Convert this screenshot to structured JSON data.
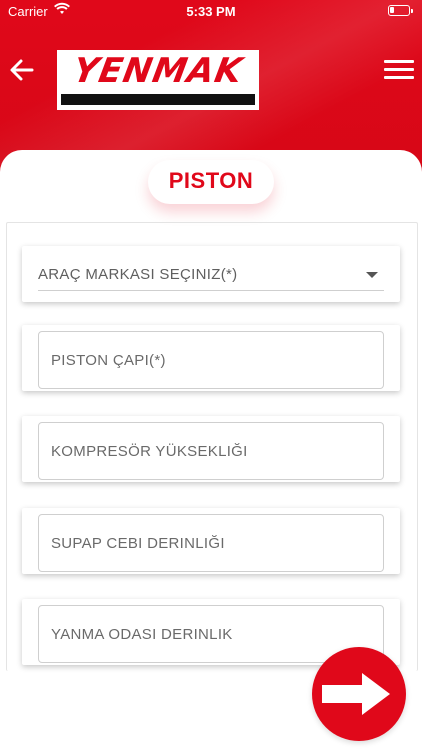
{
  "status_bar": {
    "carrier": "Carrier",
    "time": "5:33 PM"
  },
  "header": {
    "brand_logo_text": "YENMAK",
    "back_icon": "arrow-left-icon",
    "menu_icon": "hamburger-menu-icon",
    "accent_color": "#e0081a"
  },
  "page": {
    "title": "PISTON"
  },
  "form": {
    "brand_select": {
      "label": "ARAÇ MARKASI SEÇINIZ(*)",
      "icon": "dropdown-caret-icon"
    },
    "fields": [
      {
        "placeholder": "PISTON ÇAPI(*)"
      },
      {
        "placeholder": "KOMPRESÖR YÜKSEKLIĞI"
      },
      {
        "placeholder": "SUPAP CEBI DERINLIĞI"
      },
      {
        "placeholder": "YANMA ODASI DERINLIK"
      }
    ]
  },
  "actions": {
    "next_icon": "arrow-right-icon"
  }
}
